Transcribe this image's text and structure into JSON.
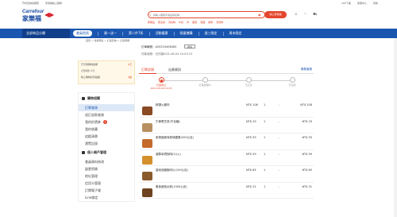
{
  "topbar": {
    "left": [
      "門市查詢與服務",
      "家樂福線上購物"
    ],
    "right": [
      "APP下載",
      "客服中心",
      "幫助"
    ]
  },
  "header": {
    "logo_en": "Carrefour",
    "logo_zh": "家樂福",
    "search_placeholder": "請輸入關鍵字或品項名稱",
    "store_button": "線上家樂福",
    "hotwords": [
      "即期品",
      "衛生紙",
      "洗衣精",
      "牛奶",
      "米",
      "雞蛋",
      "泡麵",
      "咖啡",
      "洗髮精"
    ]
  },
  "navbar": {
    "category": "全部商品分類",
    "items": [
      {
        "label": "會員首頁",
        "active": true
      },
      {
        "label": "買一送一",
        "active": false
      },
      {
        "label": "第二件7折",
        "active": false
      },
      {
        "label": "活動優惠",
        "active": false
      },
      {
        "label": "限量搶購",
        "active": false
      },
      {
        "label": "週三限定",
        "active": false
      },
      {
        "label": "周末限定",
        "active": false
      }
    ]
  },
  "breadcrumb": "首頁 > 會員專區 > 訂單查詢 > 訂單明細",
  "sidebar": {
    "promo": [
      {
        "label": "已可用購物金額",
        "value": "0元"
      },
      {
        "label": "(已扣抵) 0元",
        "value": ""
      },
      {
        "label": "線上購物紅利點數",
        "value": "0點"
      }
    ],
    "section1": "購物相關",
    "section1_items": [
      {
        "label": "訂單查詢",
        "active": true,
        "badge": ""
      },
      {
        "label": "退訂退款查詢",
        "active": false,
        "badge": ""
      },
      {
        "label": "我的折價券",
        "active": false,
        "badge": "1"
      },
      {
        "label": "我的收藏",
        "active": false,
        "badge": ""
      },
      {
        "label": "追蹤清單",
        "active": false,
        "badge": ""
      },
      {
        "label": "瀏覽記錄",
        "active": false,
        "badge": ""
      }
    ],
    "section2": "個人帳戶管理",
    "section2_items": [
      {
        "label": "會員資料修改",
        "active": false
      },
      {
        "label": "變更密碼",
        "active": false
      },
      {
        "label": "地址管理",
        "active": false
      },
      {
        "label": "信用卡管理",
        "active": false
      },
      {
        "label": "訂閱電子報",
        "active": false
      },
      {
        "label": "Line綁定",
        "active": false
      }
    ]
  },
  "order": {
    "number_label": "訂單編號：A20210406400",
    "copy_label": "複製",
    "status": "付款狀態：已付款",
    "date": "2021-06-04 10:03:13",
    "tabs": [
      "訂單詳情",
      "出貨資訊"
    ],
    "help": "聯繫客服",
    "steps": [
      "訂單成立",
      "訂單處理中",
      "已出貨",
      "已完成"
    ],
    "step_sub": [
      "2021-06-04 10:03",
      "",
      "",
      ""
    ],
    "items": [
      {
        "name": "精選火雞肉",
        "price": "NT$ 108",
        "qty": "1",
        "total": "NT$ 108",
        "color": "#8a4a24"
      },
      {
        "name": "牛蒡黑豆茶(不含糖)",
        "price": "NT$ 29",
        "qty": "1",
        "total": "NT$ 29",
        "color": "#b89060"
      },
      {
        "name": "家樂福美味原味腰果(500公克)",
        "price": "NT$ 59",
        "qty": "1",
        "total": "NT$ 59",
        "color": "#c46a2c"
      },
      {
        "name": "香醇拿鐵咖啡(24入)",
        "price": "NT$ 59",
        "qty": "1",
        "total": "NT$ 59",
        "color": "#d4902c"
      },
      {
        "name": "香純燻雞胸肉片(100公克)",
        "price": "NT$ 65",
        "qty": "1",
        "total": "NT$ 65",
        "color": "#8b5a2b"
      },
      {
        "name": "素食蔬菜水餃(1000公克)",
        "price": "NT$ 31",
        "qty": "1",
        "total": "NT$ 31",
        "color": "#6e4420"
      }
    ]
  }
}
